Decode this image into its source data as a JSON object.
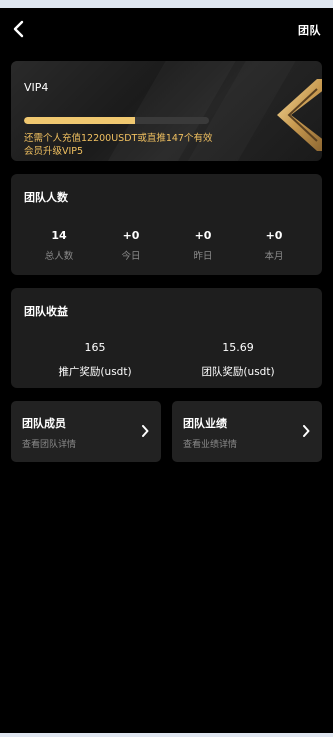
{
  "header": {
    "title": "团队",
    "back_icon": "chevron-left-icon"
  },
  "vip": {
    "level": "VIP4",
    "progress_fraction": 0.6,
    "note": "还需个人充值12200USDT或直推147个有效会员升级VIP5",
    "accent_color": "#f0c870",
    "emblem_icon": "gold-chevron-emblem"
  },
  "team_count": {
    "title": "团队人数",
    "stats": [
      {
        "value": "14",
        "label": "总人数"
      },
      {
        "value": "+0",
        "label": "今日"
      },
      {
        "value": "+0",
        "label": "昨日"
      },
      {
        "value": "+0",
        "label": "本月"
      }
    ]
  },
  "team_earnings": {
    "title": "团队收益",
    "items": [
      {
        "value": "165",
        "label": "推广奖励(usdt)"
      },
      {
        "value": "15.69",
        "label": "团队奖励(usdt)"
      }
    ]
  },
  "links": [
    {
      "title": "团队成员",
      "subtitle": "查看团队详情",
      "icon": "chevron-right-icon"
    },
    {
      "title": "团队业绩",
      "subtitle": "查看业绩详情",
      "icon": "chevron-right-icon"
    }
  ]
}
